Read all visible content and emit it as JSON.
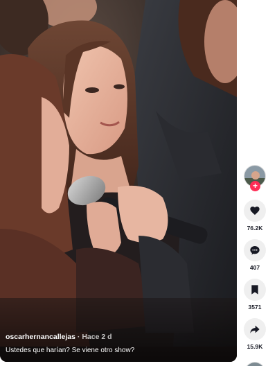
{
  "video": {
    "author": "oscarhernancallejas",
    "separator": "·",
    "posted_time": "Hace 2 d",
    "description": "Ustedes que harían? Se viene otro show?"
  },
  "actions": {
    "likes": "76.2K",
    "comments": "407",
    "saves": "3571",
    "shares": "15.9K"
  },
  "colors": {
    "follow_badge": "#fe2c55",
    "action_button_bg": "#efefef",
    "count_text": "#161823"
  },
  "icons": [
    "heart-icon",
    "comment-icon",
    "bookmark-icon",
    "share-icon",
    "plus-icon"
  ]
}
